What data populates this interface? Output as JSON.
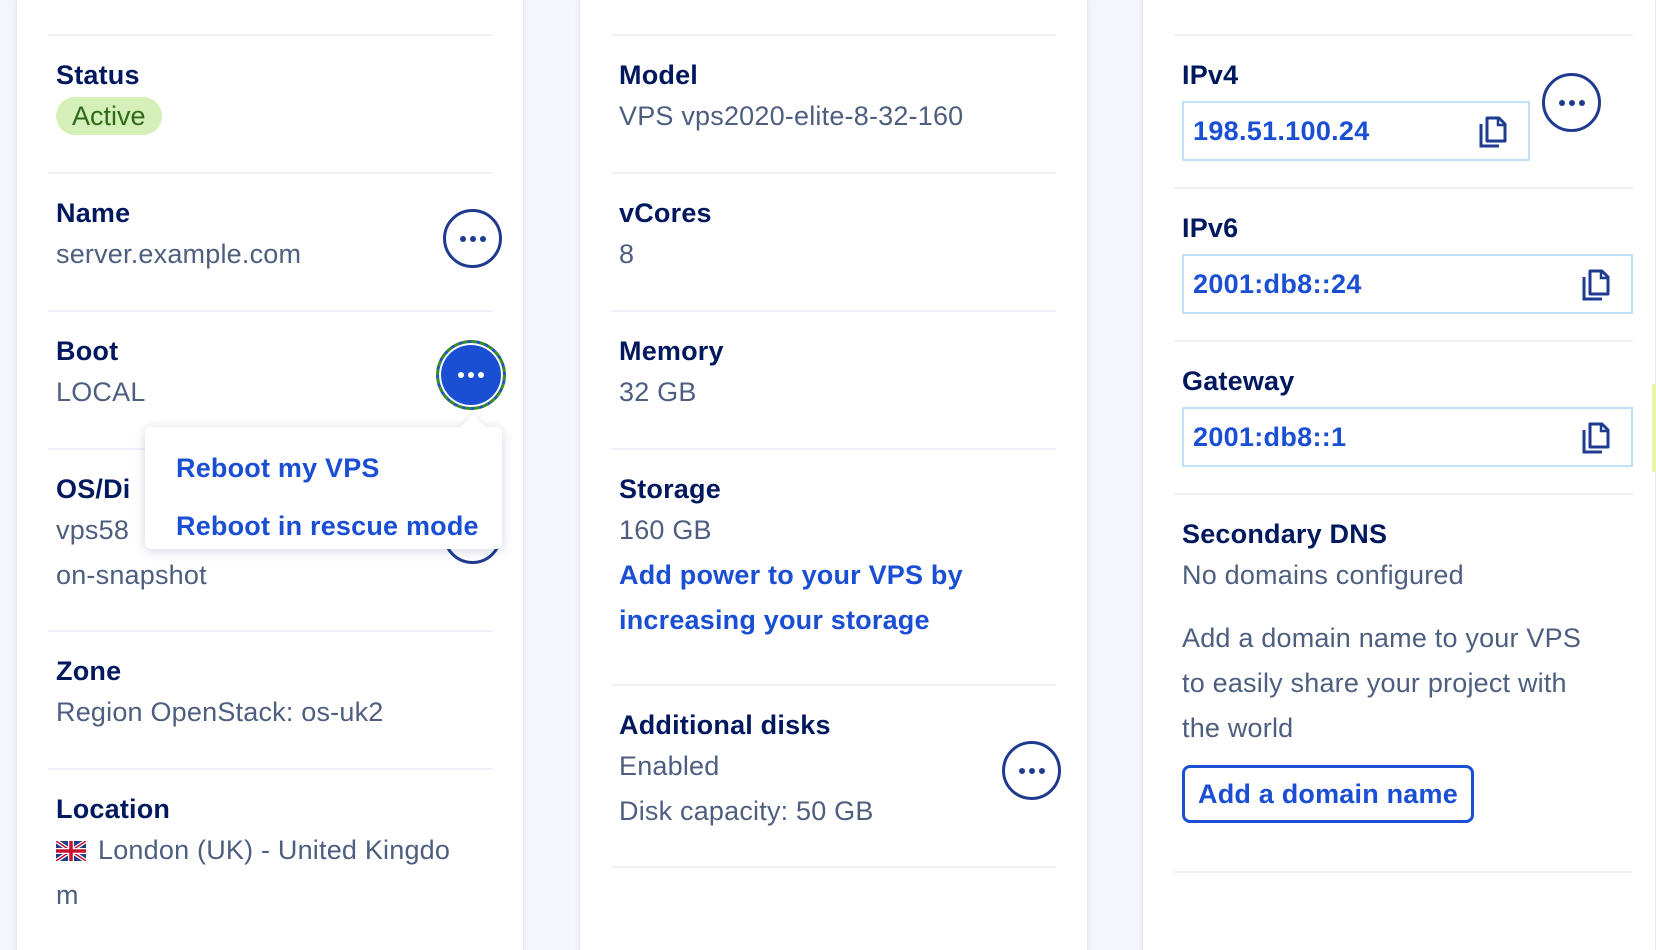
{
  "general": {
    "status_label": "Status",
    "status_value": "Active",
    "name_label": "Name",
    "name_value": "server.example.com",
    "boot_label": "Boot",
    "boot_value": "LOCAL",
    "os_label": "OS/Di",
    "os_value_line1": "vps58",
    "os_value_line2": "on-snapshot",
    "zone_label": "Zone",
    "zone_value": "Region OpenStack: os-uk2",
    "location_label": "Location",
    "location_value_line1": "London (UK) - United Kingdo",
    "location_value_line2": "m",
    "location_flag": "uk-flag-icon"
  },
  "boot_menu": {
    "items": [
      "Reboot my VPS",
      "Reboot in rescue mode"
    ]
  },
  "config": {
    "model_label": "Model",
    "model_value": "VPS vps2020-elite-8-32-160",
    "vcores_label": "vCores",
    "vcores_value": "8",
    "memory_label": "Memory",
    "memory_value": "32 GB",
    "storage_label": "Storage",
    "storage_value": "160 GB",
    "storage_link_line1": "Add power to your VPS by",
    "storage_link_line2": "increasing your storage",
    "disks_label": "Additional disks",
    "disks_status": "Enabled",
    "disks_capacity": "Disk capacity: 50 GB"
  },
  "network": {
    "ipv4_label": "IPv4",
    "ipv4_value": "198.51.100.24",
    "ipv6_label": "IPv6",
    "ipv6_value": "2001:db8::24",
    "gateway_label": "Gateway",
    "gateway_value": "2001:db8::1",
    "dns_label": "Secondary DNS",
    "dns_value": "No domains configured",
    "dns_help_line1": "Add a domain name to your VPS",
    "dns_help_line2": "to easily share your project with",
    "dns_help_line3": "the world",
    "add_domain_button": "Add a domain name"
  },
  "colors": {
    "primary": "#1a4fd4",
    "navy": "#00185e",
    "muted": "#4d5e7f",
    "success_bg": "#d4efb7",
    "success_text": "#2e6a17"
  }
}
